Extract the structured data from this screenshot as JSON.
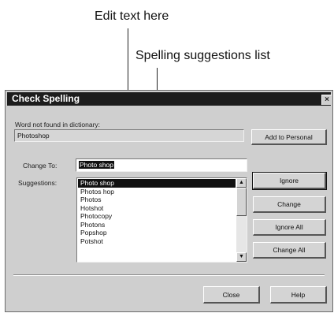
{
  "annotations": {
    "edit_text": "Edit text here",
    "suggestions_list": "Spelling suggestions list"
  },
  "dialog": {
    "title": "Check Spelling",
    "close_glyph": "×",
    "not_found_label": "Word not found in dictionary:",
    "not_found_value": "Photoshop",
    "change_to_label": "Change To:",
    "change_to_value": "Photo shop",
    "suggestions_label": "Suggestions:",
    "suggestions": [
      "Photo shop",
      "Photos hop",
      "Photos",
      "Hotshot",
      "Photocopy",
      "Photons",
      "Popshop",
      "Potshot"
    ],
    "selected_index": 0,
    "buttons": {
      "add_to_personal": "Add to Personal",
      "ignore": "Ignore",
      "change": "Change",
      "ignore_all": "Ignore All",
      "change_all": "Change All",
      "close": "Close",
      "help": "Help"
    },
    "scroll_up_glyph": "▲",
    "scroll_down_glyph": "▼"
  }
}
